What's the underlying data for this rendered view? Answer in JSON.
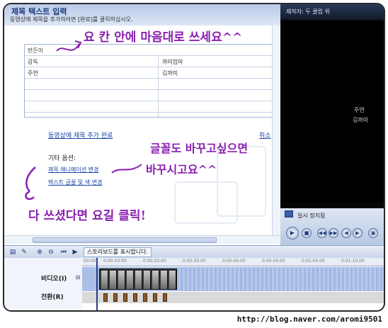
{
  "pane": {
    "title": "제목 텍스트 입력",
    "subtitle": "동영상에 제목을 추가하려면 [완료]를 클릭하십시오.",
    "table": {
      "rows": [
        [
          "만든이",
          ""
        ],
        [
          "감독",
          "까미엄마"
        ],
        [
          "주연",
          "김까미"
        ],
        [
          "",
          ""
        ],
        [
          "",
          ""
        ],
        [
          "",
          ""
        ]
      ]
    },
    "done_link": "동영상에 제목 추가 완료",
    "cancel_link": "취소",
    "other_options_label": "기타 옵션:",
    "animation_link": "제목 애니메이션 변경",
    "font_link": "텍스트 글꼴 및 색 변경"
  },
  "preview": {
    "title": "제작자: 두 클립 위",
    "screen_line1": "주연",
    "screen_line2": "김까미",
    "status": "일시 정지됨",
    "buttons": [
      "▶",
      "■",
      "◀◀",
      "▶▶",
      "◀",
      "▶",
      "▣"
    ]
  },
  "timeline": {
    "storyboard_label": "스토리보드를 표시합니다.",
    "ruler": [
      "00:00",
      "0:00:10.00",
      "0:00:20.00",
      "0:00:30.00",
      "0:00:40.00",
      "0:00:50.00",
      "0:01:00.00",
      "0:01:10.00"
    ],
    "video_label": "비디오(I)",
    "transition_label": "전환(R)"
  },
  "annotations": {
    "a1": "요 칸 안에 마음대로 쓰세요^^",
    "a2": "글꼴도 바꾸고싶으면",
    "a3": "바꾸시고요^^",
    "a4": "다 쓰셨다면 요길 클릭!"
  },
  "footer": {
    "url": "http://blog.naver.com/aromi9501"
  },
  "colors": {
    "annotation": "#8a1fb0",
    "link": "#1a43a8",
    "timeline_bg": "#a9bfe6"
  }
}
